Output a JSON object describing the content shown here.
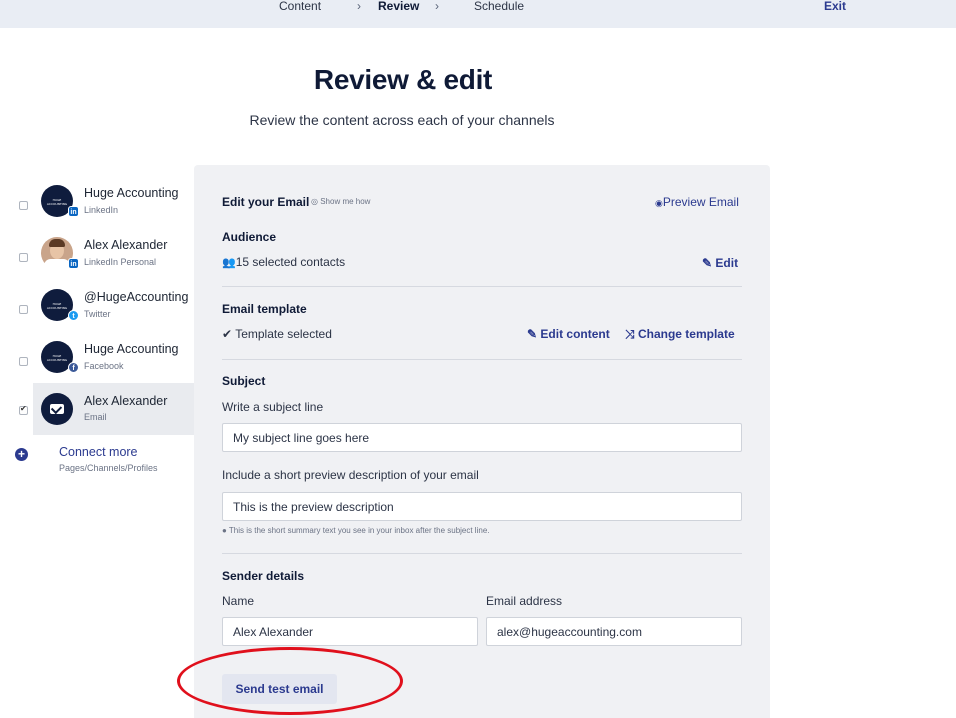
{
  "nav": {
    "steps": [
      "Content",
      "Review",
      "Schedule"
    ],
    "exit": "Exit"
  },
  "header": {
    "title": "Review & edit",
    "subtitle": "Review the content across each of your channels"
  },
  "sidebar": {
    "channels": [
      {
        "name": "Huge Accounting",
        "type": "LinkedIn",
        "checked": false,
        "avatar_text": "HUGE ACCOUNTING"
      },
      {
        "name": "Alex Alexander",
        "type": "LinkedIn Personal",
        "checked": false
      },
      {
        "name": "@HugeAccounting",
        "type": "Twitter",
        "checked": false,
        "avatar_text": "HUGE ACCOUNTING"
      },
      {
        "name": "Huge Accounting",
        "type": "Facebook",
        "checked": false,
        "avatar_text": "HUGE ACCOUNTING"
      },
      {
        "name": "Alex Alexander",
        "type": "Email",
        "checked": true
      }
    ],
    "connect_more": "Connect more",
    "connect_more_sub": "Pages/Channels/Profiles"
  },
  "editor": {
    "title": "Edit your Email",
    "show_me_how": "Show me how",
    "preview_email": "Preview Email",
    "audience": {
      "heading": "Audience",
      "contacts": "15 selected contacts",
      "edit": "Edit"
    },
    "template": {
      "heading": "Email template",
      "status": "Template selected",
      "edit_content": "Edit content",
      "change_template": "Change template"
    },
    "subject": {
      "heading": "Subject",
      "label": "Write a subject line",
      "value": "My subject line goes here",
      "preview_label": "Include a short preview description of your email",
      "preview_value": "This is the preview description",
      "hint": "This is the short summary text you see in your inbox after the subject line."
    },
    "sender": {
      "heading": "Sender details",
      "name_label": "Name",
      "name_value": "Alex Alexander",
      "email_label": "Email address",
      "email_value": "alex@hugeaccounting.com"
    },
    "send_test": "Send test email"
  },
  "colors": {
    "accent": "#2b3a8f",
    "navy": "#0f1c3d",
    "panel": "#f0f1f4",
    "annotation": "#e0101c"
  }
}
